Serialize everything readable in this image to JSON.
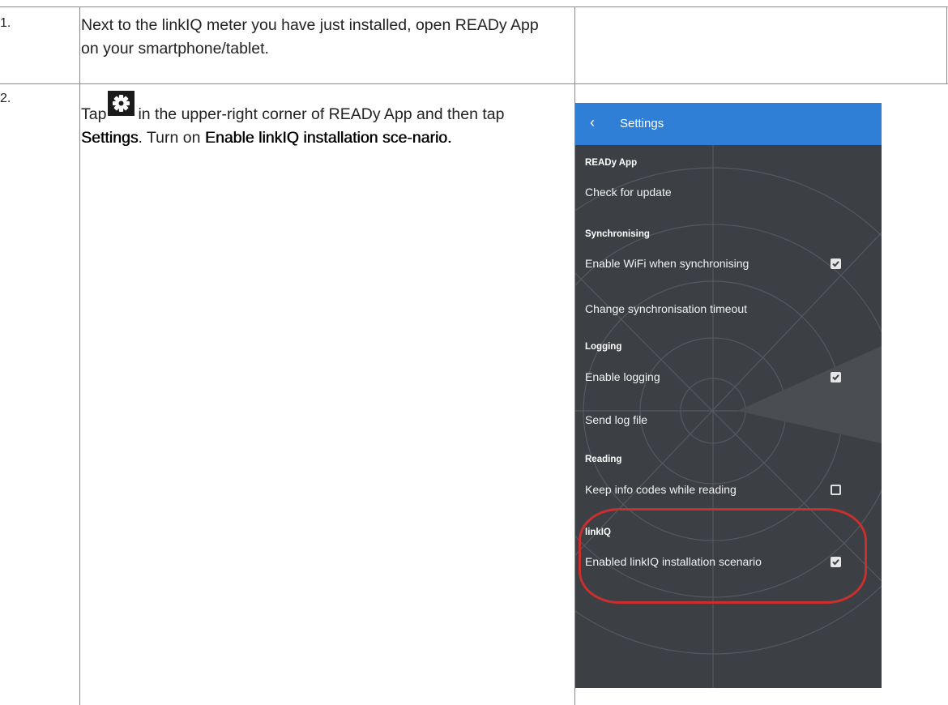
{
  "steps": [
    {
      "number": "1.",
      "text": "Next to the linkIQ meter you have just installed, open READy App on your smartphone/tablet."
    },
    {
      "number": "2.",
      "text_before_icon": "Tap",
      "text_after_icon": "in the upper-right corner of READy App and then tap",
      "bold_settings": "Settings",
      "text_mid": ". Turn on",
      "bold_option": "Enable linkIQ installation sce-nario."
    }
  ],
  "icon": {
    "name": "gear-icon"
  },
  "phone_screen": {
    "header": {
      "back_glyph": "‹",
      "title": "Settings",
      "color": "#2f7fd6"
    },
    "sections": [
      {
        "heading": "READy App",
        "items": [
          {
            "label": "Check for update",
            "checkbox": "none"
          }
        ]
      },
      {
        "heading": "Synchronising",
        "items": [
          {
            "label": "Enable WiFi when synchronising",
            "checkbox": "checked"
          },
          {
            "label": "Change synchronisation timeout",
            "checkbox": "none"
          }
        ]
      },
      {
        "heading": "Logging",
        "items": [
          {
            "label": "Enable logging",
            "checkbox": "checked"
          },
          {
            "label": "Send log file",
            "checkbox": "none"
          }
        ]
      },
      {
        "heading": "Reading",
        "items": [
          {
            "label": "Keep info codes while reading",
            "checkbox": "unchecked"
          }
        ]
      },
      {
        "heading": "linkIQ",
        "items": [
          {
            "label": "Enabled linkIQ installation scenario",
            "checkbox": "checked"
          }
        ]
      }
    ],
    "highlight_color": "#c8302f"
  }
}
